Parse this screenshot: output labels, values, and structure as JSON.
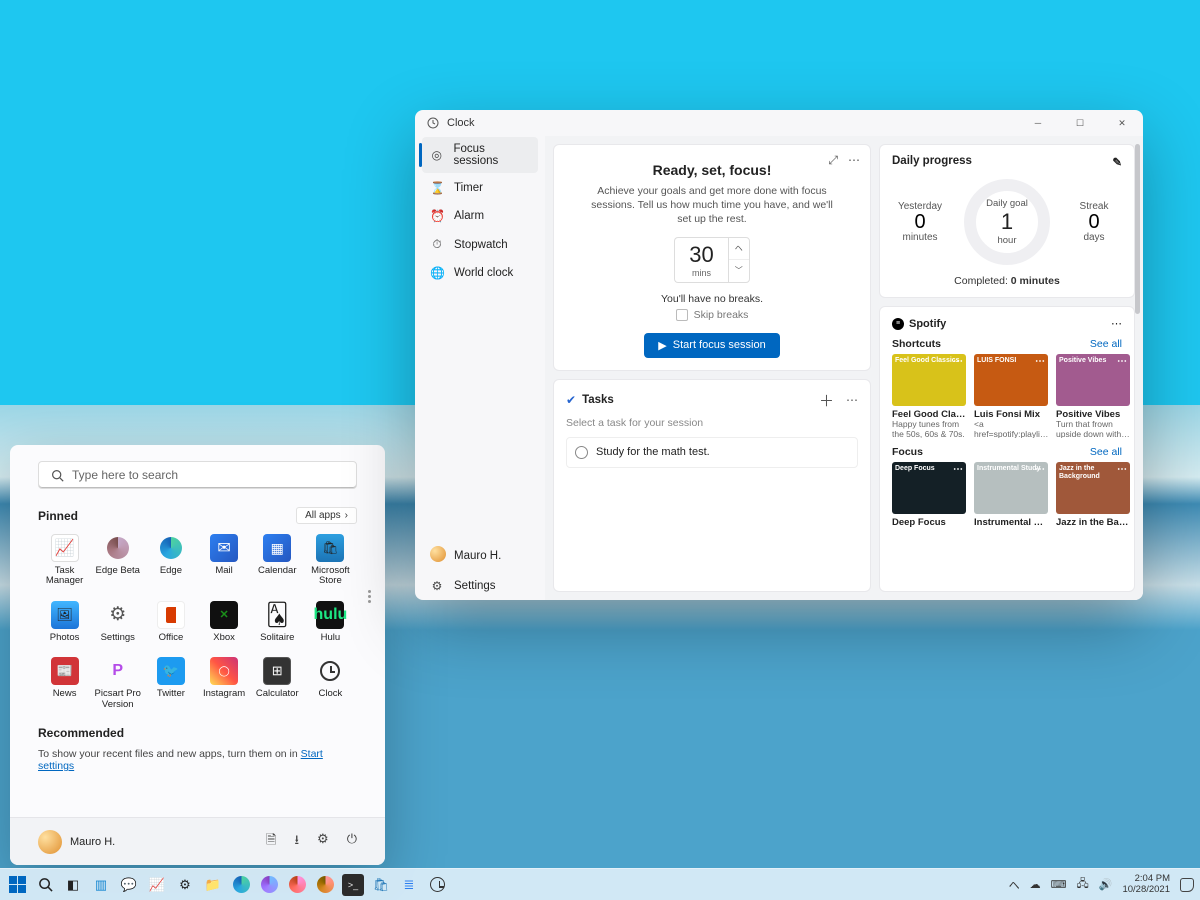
{
  "start": {
    "search_placeholder": "Type here to search",
    "pinned_label": "Pinned",
    "all_apps_label": "All apps",
    "apps": [
      {
        "name": "Task Manager"
      },
      {
        "name": "Edge Beta"
      },
      {
        "name": "Edge"
      },
      {
        "name": "Mail"
      },
      {
        "name": "Calendar"
      },
      {
        "name": "Microsoft Store"
      },
      {
        "name": "Photos"
      },
      {
        "name": "Settings"
      },
      {
        "name": "Office"
      },
      {
        "name": "Xbox"
      },
      {
        "name": "Solitaire"
      },
      {
        "name": "Hulu"
      },
      {
        "name": "News"
      },
      {
        "name": "Picsart Pro Version"
      },
      {
        "name": "Twitter"
      },
      {
        "name": "Instagram"
      },
      {
        "name": "Calculator"
      },
      {
        "name": "Clock"
      }
    ],
    "recommended_label": "Recommended",
    "recommended_msg": "To show your recent files and new apps, turn them on in ",
    "recommended_link": "Start settings",
    "user": "Mauro H."
  },
  "clock": {
    "title": "Clock",
    "nav": [
      "Focus sessions",
      "Timer",
      "Alarm",
      "Stopwatch",
      "World clock"
    ],
    "user": "Mauro H.",
    "settings": "Settings",
    "focus": {
      "title": "Ready, set, focus!",
      "sub": "Achieve your goals and get more done with focus sessions. Tell us how much time you have, and we'll set up the rest.",
      "duration": "30",
      "duration_unit": "mins",
      "breaks": "You'll have no breaks.",
      "skip": "Skip breaks",
      "start": "Start focus session"
    },
    "tasks": {
      "title": "Tasks",
      "hint": "Select a task for your session",
      "item": "Study for the math test."
    },
    "progress": {
      "title": "Daily progress",
      "yesterday_l": "Yesterday",
      "yesterday_v": "0",
      "yesterday_u": "minutes",
      "goal_l": "Daily goal",
      "goal_v": "1",
      "goal_u": "hour",
      "streak_l": "Streak",
      "streak_v": "0",
      "streak_u": "days",
      "completed_l": "Completed: ",
      "completed_v": "0 minutes"
    },
    "spotify": {
      "brand": "Spotify",
      "shortcuts": "Shortcuts",
      "focus": "Focus",
      "see_all": "See all",
      "tiles1": [
        {
          "name": "Feel Good Classics",
          "sub": "Happy tunes from the 50s, 60s & 70s.",
          "bg": "#d8c21a",
          "txt": "Feel Good Classics"
        },
        {
          "name": "Luis Fonsi Mix",
          "sub": "<a href=spotify:playli…",
          "bg": "#c65a12",
          "txt": "LUIS FONSI"
        },
        {
          "name": "Positive Vibes",
          "sub": "Turn that frown upside down with…",
          "bg": "#a25b8f",
          "txt": "Positive Vibes"
        }
      ],
      "tiles2": [
        {
          "name": "Deep Focus",
          "bg": "#142026",
          "txt": "Deep Focus"
        },
        {
          "name": "Instrumental Study",
          "bg": "#b6bfbf",
          "txt": "Instrumental Study"
        },
        {
          "name": "Jazz in the Backg…",
          "bg": "#a0583a",
          "txt": "Jazz in the Background"
        }
      ]
    }
  },
  "taskbar": {
    "time": "2:04 PM",
    "date": "10/28/2021"
  }
}
